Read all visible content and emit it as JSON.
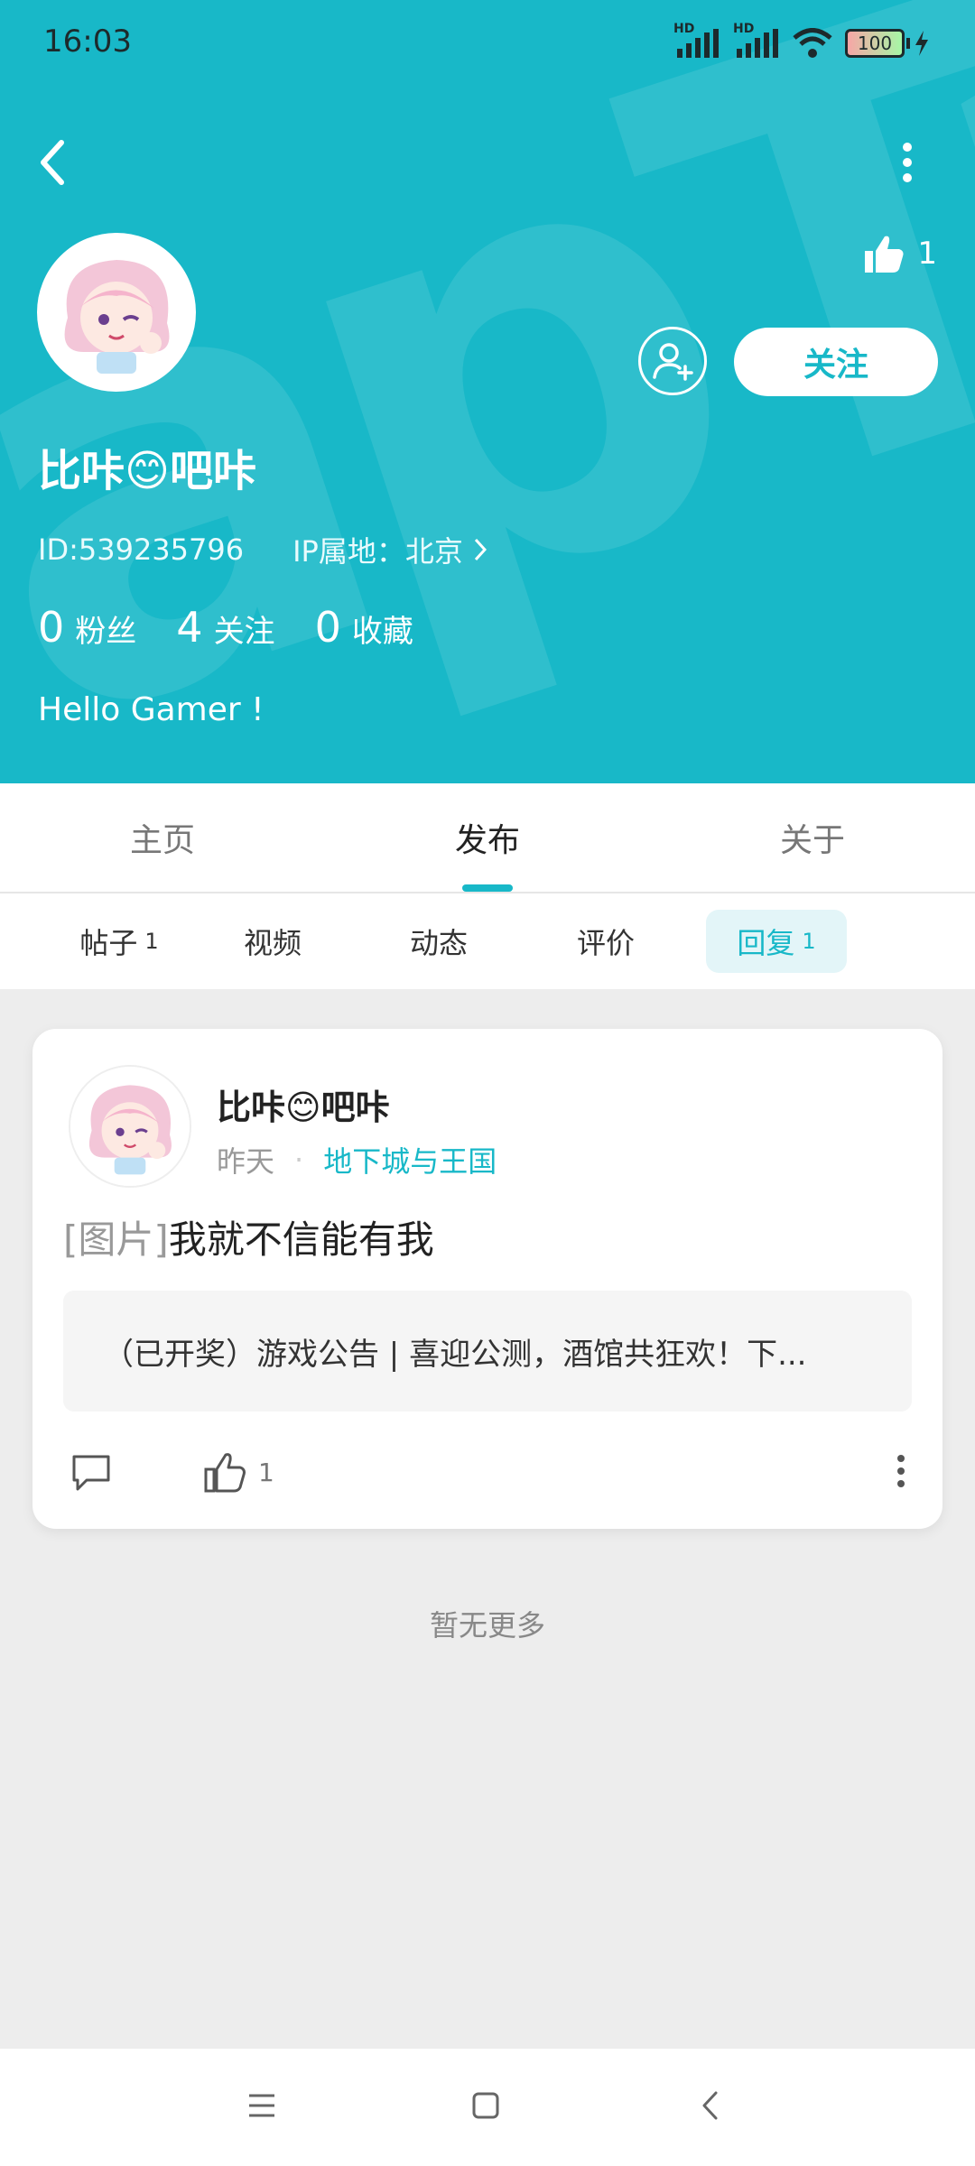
{
  "status_bar": {
    "time": "16:03",
    "network1": "HD",
    "network2": "HD",
    "battery": "100"
  },
  "profile": {
    "name": "比咔😊吧咔",
    "id_text": "ID:539235796",
    "ip_text": "IP属地：北京",
    "likes_count": "1",
    "follow_label": "关注",
    "bio": "Hello Gamer !",
    "stats": [
      {
        "num": "0",
        "label": "粉丝"
      },
      {
        "num": "4",
        "label": "关注"
      },
      {
        "num": "0",
        "label": "收藏"
      }
    ]
  },
  "tabs": [
    {
      "label": "主页"
    },
    {
      "label": "发布"
    },
    {
      "label": "关于"
    }
  ],
  "subtabs": [
    {
      "label": "帖子",
      "count": "1"
    },
    {
      "label": "视频",
      "count": ""
    },
    {
      "label": "动态",
      "count": ""
    },
    {
      "label": "评价",
      "count": ""
    },
    {
      "label": "回复",
      "count": "1"
    }
  ],
  "post": {
    "author": "比咔😊吧咔",
    "time": "昨天",
    "game": "地下城与王国",
    "tag": "[图片]",
    "text": "我就不信能有我",
    "quote": "（已开奖）游戏公告 | 喜迎公测，酒馆共狂欢！下...",
    "likes": "1"
  },
  "footer": {
    "no_more": "暂无更多"
  },
  "colors": {
    "accent": "#18b8c8"
  },
  "icons": [
    "back-icon",
    "more-vertical-icon",
    "thumb-up-icon",
    "add-friend-icon",
    "chevron-right-icon",
    "comment-icon",
    "menu-icon",
    "home-icon"
  ]
}
